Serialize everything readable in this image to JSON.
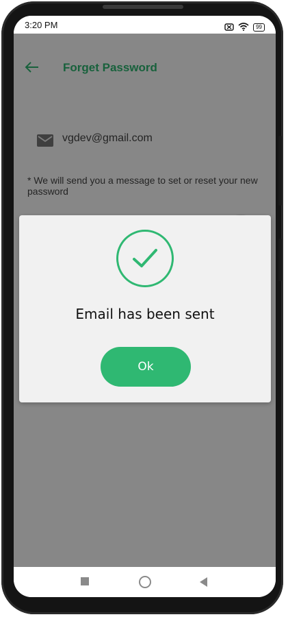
{
  "status_bar": {
    "time": "3:20 PM",
    "battery": "99",
    "icons": [
      "notification-off-icon",
      "wifi-icon",
      "battery-icon"
    ]
  },
  "header": {
    "title": "Forget Password",
    "back_icon": "back-arrow-icon"
  },
  "form": {
    "email_icon": "mail-icon",
    "email_value": "vgdev@gmail.com",
    "hint": "*  We will send you a message to set or reset your new password"
  },
  "dialog": {
    "icon": "check-circle-icon",
    "message": "Email has been sent",
    "ok_label": "Ok"
  },
  "nav_bar": {
    "icons": [
      "recent-apps-icon",
      "home-icon",
      "back-icon"
    ]
  },
  "colors": {
    "accent": "#2fb872",
    "scrim": "rgba(0,0,0,0.47)",
    "dialog_bg": "#f1f1f1"
  }
}
